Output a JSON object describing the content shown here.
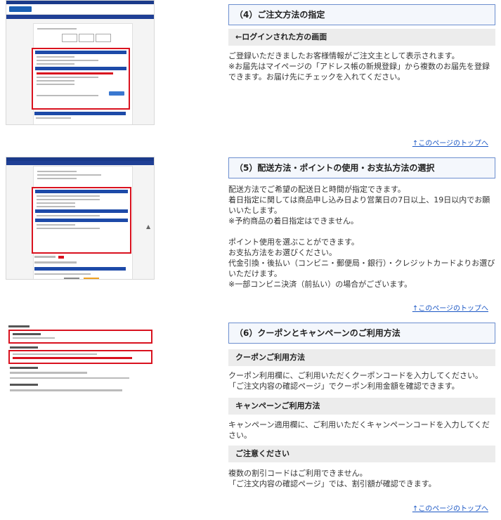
{
  "sections": [
    {
      "title": "（4）ご注文方法の指定",
      "subtitle": "←ログインされた方の画面",
      "paragraphs": [
        "ご登録いただきましたお客様情報がご注文主として表示されます。\n※お届先はマイページの「アドレス帳の新規登録」から複数のお届先を登録できます。お届け先にチェックを入れてください。"
      ]
    },
    {
      "title": "（5）配送方法・ポイントの使用・お支払方法の選択",
      "paragraphs": [
        "配送方法でご希望の配送日と時間が指定できます。\n着日指定に関しては商品申し込み日より営業日の7日以上、19日以内でお願いいたします。\n※予約商品の着日指定はできません。",
        "ポイント使用を選ぶことができます。\nお支払方法をお選びください。\n代金引換・後払い（コンビニ・郵便局・銀行）・クレジットカードよりお選びいただけます。\n※一部コンビニ決済（前払い）の場合がございます。"
      ]
    },
    {
      "title": "（6）クーポンとキャンペーンのご利用方法",
      "subsections": [
        {
          "subtitle": "クーポンご利用方法",
          "text": "クーポン利用欄に、ご利用いただくクーポンコードを入力してください。\n「ご注文内容の確認ページ」でクーポン利用金額を確認できます。"
        },
        {
          "subtitle": "キャンペーンご利用方法",
          "text": "キャンペーン適用欄に、ご利用いただくキャンペーンコードを入力してください。"
        },
        {
          "subtitle": "ご注意ください",
          "text": "複数の割引コードはご利用できません。\n「ご注文内容の確認ページ」では、割引額が確認できます。"
        }
      ]
    }
  ],
  "back_to_top": "↑このページのトップへ",
  "colors": {
    "title_border": "#6c8ecf",
    "title_bg": "#f4f7fc",
    "sub_bg": "#ececec",
    "link": "#1a56c4",
    "highlight": "#d9121f"
  }
}
